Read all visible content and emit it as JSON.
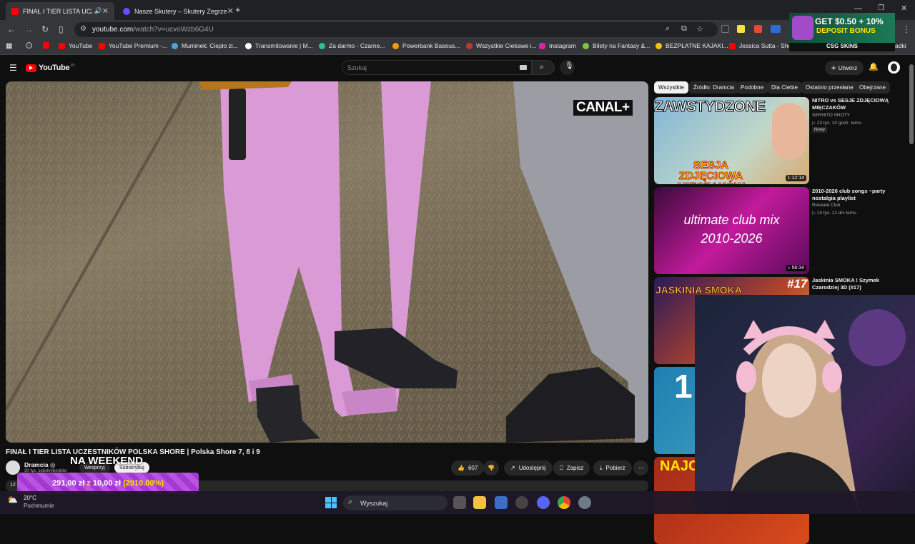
{
  "browser": {
    "tabs": [
      {
        "title": "FINAŁ I TIER LISTA UCZESTNI",
        "active": true
      },
      {
        "title": "Nasze Skutery – Skutery Zegrze",
        "active": false
      }
    ],
    "new_tab": "+",
    "url_host": "youtube.com",
    "url_path": "/watch?v=ucvoWzb6G4U",
    "bookmarks": [
      "YouTube",
      "YouTube Premium -...",
      "Muminek: Ciepło zi...",
      "Transmitowanie | M...",
      "Za darmo - Czarne...",
      "Powerbank Baseus...",
      "Wszystkie Ciekawe i...",
      "Instagram",
      "Bilety na Fantasy &...",
      "BEZPŁATNE KAJAKI...",
      "Jessica Sutta - Show",
      "adki"
    ]
  },
  "youtube": {
    "logo": "YouTube",
    "region": "PL",
    "search_placeholder": "Szukaj",
    "create_label": "Utwórz",
    "chips": [
      "Wszystkie",
      "Źródło: Dramcia",
      "Podobne",
      "Dla Ciebie",
      "Ostatnio przesłane",
      "Obejrzane"
    ]
  },
  "video": {
    "watermark": "CANAL+",
    "title": "FINAŁ I TIER LISTA UCZESTNIKÓW POLSKA SHORE | Polska Shore 7, 8 i 9",
    "channel": "Dramcia",
    "subscribers": "30 tys. subskrybentów",
    "support_label": "Wesprzyj",
    "subscribe_label": "Subskrybuj",
    "likes": "607",
    "share_label": "Udostępnij",
    "save_label": "Zapisz",
    "download_label": "Pobierz",
    "views_prefix": "12"
  },
  "recommendations": [
    {
      "thumb_text_top": "ZAWSTYDZONE",
      "thumb_text_bottom": "SESJA ZDJĘCIOWA MIĘCZAKÓW",
      "duration": "1:12:14",
      "title": "NITRO vs SESJE ZDJĘCIOWĄ MIĘCZAKÓW",
      "channel": "SERHITO SHOTY",
      "meta": "▷ 23 tys.  10 godz. temu",
      "badge": "Nowy"
    },
    {
      "thumb_text_top": "ultimate club mix",
      "thumb_text_bottom": "2010-2026",
      "duration": "♪ 56:34",
      "title": "2010-2026 club songs ~party nostalgia playlist",
      "channel": "Roseate Club",
      "meta": "▷ 14 tys.  12 dni temu",
      "badge": ""
    },
    {
      "thumb_text_top": "JASKINIA SMOKA",
      "thumb_text_bottom": "#17",
      "duration": "",
      "title": "Jaskinia SMOKA ! Szymek Czarodziej 3D (#17)",
      "channel": "",
      "meta": "",
      "badge": ""
    },
    {
      "thumb_text_top": "1",
      "thumb_text_bottom": "",
      "duration": "",
      "title": "",
      "channel": "",
      "meta": "",
      "badge": ""
    },
    {
      "thumb_text_top": "NAJC",
      "thumb_text_bottom": "",
      "duration": "",
      "title": "",
      "channel": "",
      "meta": "",
      "badge": ""
    }
  ],
  "overlays": {
    "ad_line1": "GET $0.50 + 10%",
    "ad_line2": "DEPOSIT BONUS",
    "ad_brand": "CSG SKINS",
    "weekend_text": "NA WEEKEND",
    "donation_text_a": "291,00 zł",
    "donation_text_b": "z",
    "donation_text_c": "10,00 zł",
    "donation_text_d": "(2910.00%)"
  },
  "taskbar": {
    "weather_temp": "20°C",
    "weather_desc": "Pochmurnie",
    "search_label": "Wyszukaj"
  },
  "colors": {
    "youtube_red": "#ff0000",
    "donation_purple": "#b954e0",
    "accent_yellow": "#ffe600"
  }
}
